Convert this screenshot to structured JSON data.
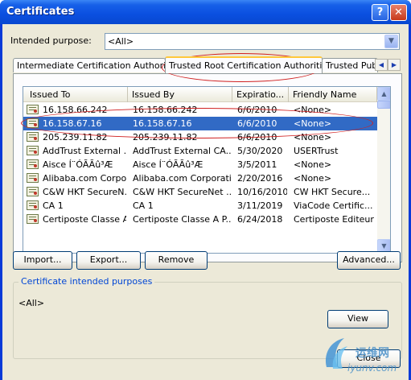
{
  "window": {
    "title": "Certificates",
    "help_label": "?",
    "close_label": "✕",
    "colors": {
      "titlebar": "#0a4fe0",
      "selection": "#316ac5",
      "annotation": "#d02020"
    }
  },
  "intended_purpose": {
    "label": "Intended purpose:",
    "value": "<All>"
  },
  "tabs": [
    {
      "label": "Intermediate Certification Authorities",
      "active": false
    },
    {
      "label": "Trusted Root Certification Authorities",
      "active": true
    },
    {
      "label": "Trusted Publ",
      "active": false
    }
  ],
  "tab_scroll": {
    "left_icon": "◀",
    "right_icon": "▶"
  },
  "list": {
    "columns": [
      "Issued To",
      "Issued By",
      "Expiratio...",
      "Friendly Name"
    ],
    "rows": [
      {
        "issued_to": "16.158.66.242",
        "issued_by": "16.158.66.242",
        "expiration": "6/6/2010",
        "friendly_name": "<None>"
      },
      {
        "issued_to": "16.158.67.16",
        "issued_by": "16.158.67.16",
        "expiration": "6/6/2010",
        "friendly_name": "<None>",
        "selected": true
      },
      {
        "issued_to": "205.239.11.82",
        "issued_by": "205.239.11.82",
        "expiration": "6/6/2010",
        "friendly_name": "<None>"
      },
      {
        "issued_to": "AddTrust External ...",
        "issued_by": "AddTrust External CA...",
        "expiration": "5/30/2020",
        "friendly_name": "USERTrust"
      },
      {
        "issued_to": "Aisce   Í¨ÓÃÃû³Æ",
        "issued_by": "Aisce   Í¨ÓÃÃû³Æ",
        "expiration": "3/5/2011",
        "friendly_name": "<None>"
      },
      {
        "issued_to": "Alibaba.com Corpor...",
        "issued_by": "Alibaba.com Corporati...",
        "expiration": "2/20/2016",
        "friendly_name": "<None>"
      },
      {
        "issued_to": "C&W HKT SecureN...",
        "issued_by": "C&W HKT SecureNet ...",
        "expiration": "10/16/2010",
        "friendly_name": "CW HKT Secure..."
      },
      {
        "issued_to": "CA 1",
        "issued_by": "CA 1",
        "expiration": "3/11/2019",
        "friendly_name": "ViaCode Certific..."
      },
      {
        "issued_to": "Certiposte Classe A...",
        "issued_by": "Certiposte Classe A P...",
        "expiration": "6/24/2018",
        "friendly_name": "Certiposte Editeur"
      }
    ]
  },
  "buttons": {
    "import": "Import...",
    "export": "Export...",
    "remove": "Remove",
    "advanced": "Advanced...",
    "view": "View",
    "close": "Close"
  },
  "purposes_group": {
    "title": "Certificate intended purposes",
    "value": "<All>"
  },
  "watermark": {
    "chinese": "运维网",
    "url": "iyunv.com"
  }
}
